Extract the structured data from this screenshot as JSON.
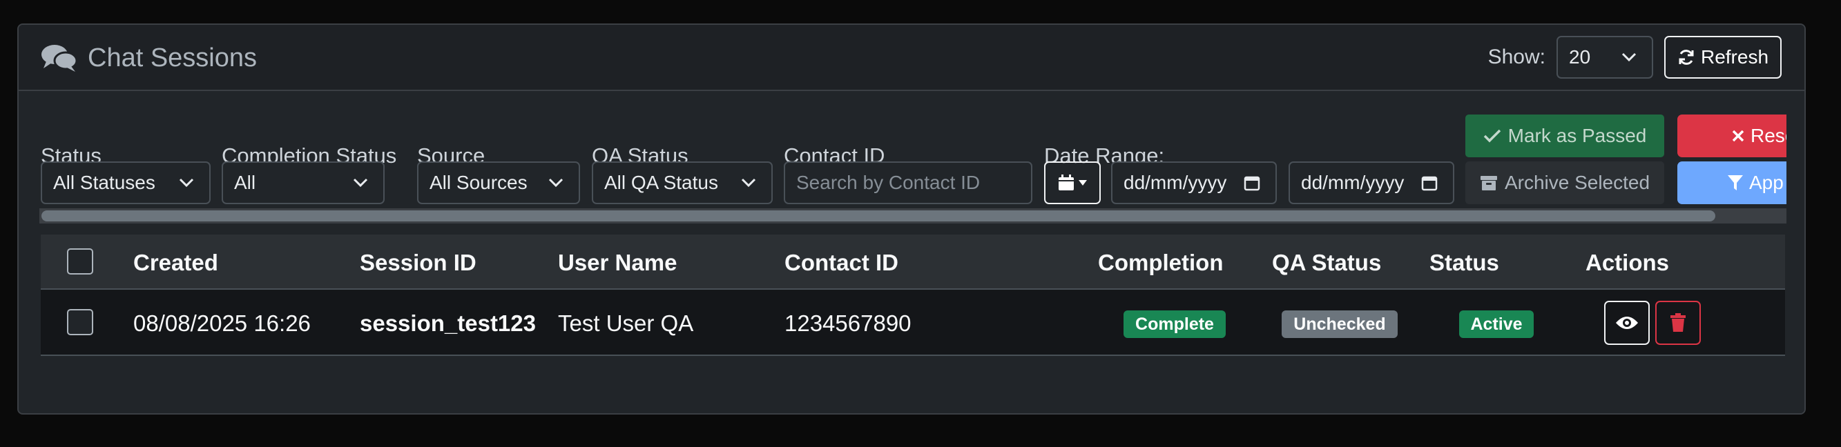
{
  "header": {
    "title": "Chat Sessions",
    "title_icon": "comments-icon",
    "show_label": "Show:",
    "show_value": "20",
    "refresh_label": "Refresh"
  },
  "filters": {
    "status_label": "Status",
    "status_value": "All Statuses",
    "completion_label": "Completion Status",
    "completion_value": "All",
    "source_label": "Source",
    "source_value": "All Sources",
    "qa_label": "QA Status",
    "qa_value": "All QA Status",
    "contact_label": "Contact ID",
    "contact_placeholder": "Search by Contact ID",
    "date_label": "Date Range:",
    "date_from_placeholder": "dd/mm/yyyy",
    "date_to_placeholder": "dd/mm/yyyy",
    "mark_passed_label": "Mark as Passed",
    "archive_label": "Archive Selected",
    "reset_label": "Rese",
    "apply_label": "App"
  },
  "table": {
    "columns": [
      "Created",
      "Session ID",
      "User Name",
      "Contact ID",
      "Completion",
      "QA Status",
      "Status",
      "Actions"
    ],
    "rows": [
      {
        "created": "08/08/2025 16:26",
        "session_id": "session_test123",
        "user_name": "Test User QA",
        "contact_id": "1234567890",
        "completion": "Complete",
        "qa_status": "Unchecked",
        "status": "Active"
      }
    ]
  },
  "colors": {
    "success": "#198754",
    "danger": "#dc3545",
    "primary_light": "#6ea8fe",
    "secondary": "#6c757d"
  }
}
